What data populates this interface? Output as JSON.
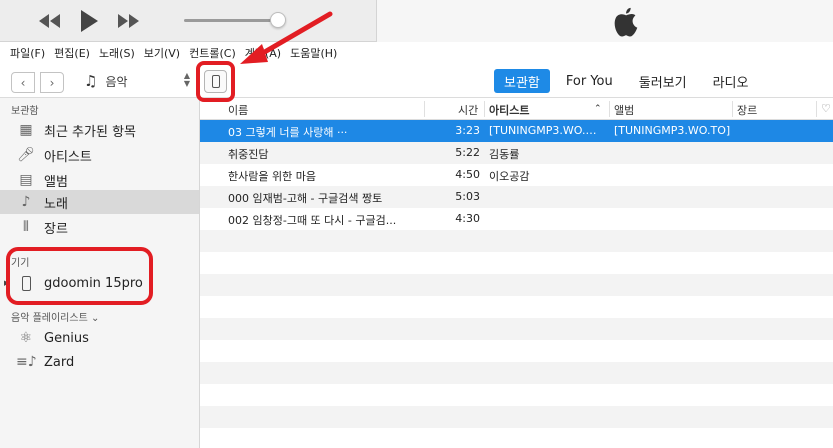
{
  "menu": [
    "파일(F)",
    "편집(E)",
    "노래(S)",
    "보기(V)",
    "컨트롤(C)",
    "계정(A)",
    "도움말(H)"
  ],
  "toolbar": {
    "media_label": "음악"
  },
  "tabs": [
    "보관함",
    "For You",
    "둘러보기",
    "라디오"
  ],
  "sidebar": {
    "library_header": "보관함",
    "library_items": [
      {
        "label": "최근 추가된 항목",
        "icon": "grid-icon"
      },
      {
        "label": "아티스트",
        "icon": "microphone-icon"
      },
      {
        "label": "앨범",
        "icon": "album-icon"
      },
      {
        "label": "노래",
        "icon": "note-icon"
      },
      {
        "label": "장르",
        "icon": "genre-icon"
      }
    ],
    "devices_header": "기기",
    "device_name": "gdoomin 15pro",
    "playlists_header": "음악 플레이리스트",
    "playlists": [
      {
        "label": "Genius",
        "icon": "atom-icon"
      },
      {
        "label": "Zard",
        "icon": "playlist-icon"
      }
    ]
  },
  "columns": {
    "name": "이름",
    "time": "시간",
    "artist": "아티스트",
    "album": "앨범",
    "genre": "장르"
  },
  "tracks": [
    {
      "name": "03 그렇게 너를 사랑해 ···",
      "time": "3:23",
      "artist": "[TUNINGMP3.WO.T...",
      "album": "[TUNINGMP3.WO.TO]"
    },
    {
      "name": "취중진담",
      "time": "5:22",
      "artist": "김동률",
      "album": ""
    },
    {
      "name": "한사람을 위한 마음",
      "time": "4:50",
      "artist": "이오공감",
      "album": ""
    },
    {
      "name": "000 임재범-고해 - 구글검색 짱토",
      "time": "5:03",
      "artist": "",
      "album": ""
    },
    {
      "name": "002 임창정-그때 또 다시 - 구글검...",
      "time": "4:30",
      "artist": "",
      "album": ""
    }
  ],
  "colors": {
    "accent": "#1e88e5",
    "highlight": "#e21d23"
  }
}
